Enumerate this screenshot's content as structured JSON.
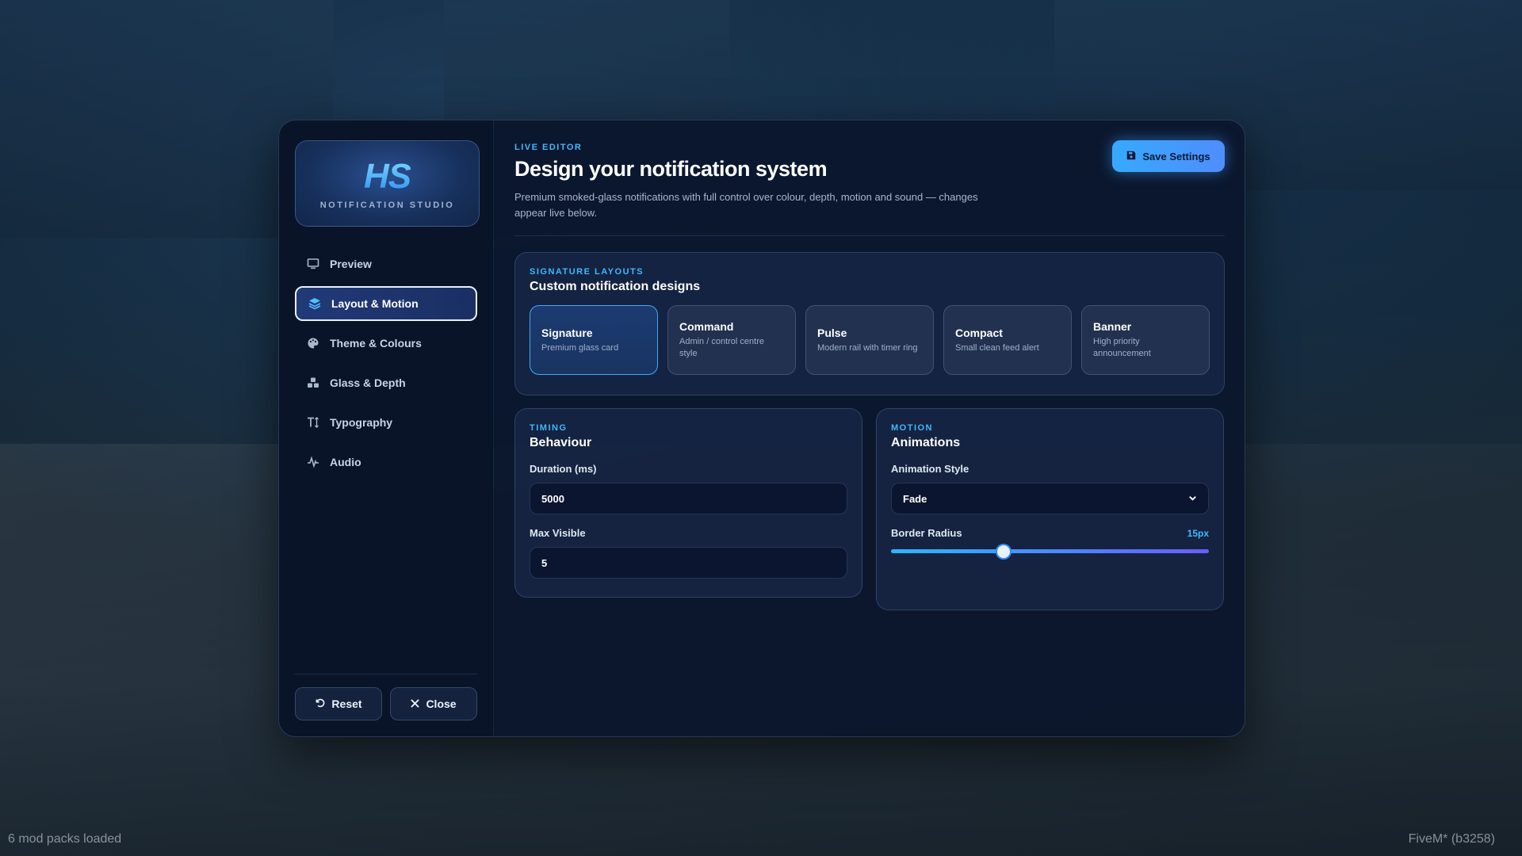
{
  "app": {
    "logo_mark": "HS",
    "logo_subtitle": "NOTIFICATION STUDIO"
  },
  "sidebar": {
    "items": [
      {
        "label": "Preview",
        "icon": "monitor-icon",
        "active": false
      },
      {
        "label": "Layout & Motion",
        "icon": "layers-icon",
        "active": true
      },
      {
        "label": "Theme & Colours",
        "icon": "palette-icon",
        "active": false
      },
      {
        "label": "Glass & Depth",
        "icon": "cubes-icon",
        "active": false
      },
      {
        "label": "Typography",
        "icon": "text-height-icon",
        "active": false
      },
      {
        "label": "Audio",
        "icon": "waveform-icon",
        "active": false
      }
    ],
    "reset_label": "Reset",
    "close_label": "Close"
  },
  "header": {
    "eyebrow": "LIVE EDITOR",
    "title": "Design your notification system",
    "description": "Premium smoked-glass notifications with full control over colour, depth, motion and sound — changes appear live below.",
    "save_label": "Save Settings"
  },
  "layouts": {
    "eyebrow": "SIGNATURE LAYOUTS",
    "title": "Custom notification designs",
    "cards": [
      {
        "name": "Signature",
        "desc": "Premium glass card",
        "selected": true
      },
      {
        "name": "Command",
        "desc": "Admin / control centre style",
        "selected": false
      },
      {
        "name": "Pulse",
        "desc": "Modern rail with timer ring",
        "selected": false
      },
      {
        "name": "Compact",
        "desc": "Small clean feed alert",
        "selected": false
      },
      {
        "name": "Banner",
        "desc": "High priority announcement",
        "selected": false
      }
    ]
  },
  "timing": {
    "eyebrow": "TIMING",
    "title": "Behaviour",
    "duration_label": "Duration (ms)",
    "duration_value": "5000",
    "max_visible_label": "Max Visible",
    "max_visible_value": "5"
  },
  "motion": {
    "eyebrow": "MOTION",
    "title": "Animations",
    "animation_style_label": "Animation Style",
    "animation_style_value": "Fade",
    "border_radius_label": "Border Radius",
    "border_radius_value": "15px",
    "border_radius_fraction": 0.355
  },
  "background": {
    "mods_text": "6 mod packs loaded",
    "build_text": "FiveM* (b3258)"
  },
  "colors": {
    "accent": "#3fb8ff",
    "window_bg": "#0b162c"
  }
}
